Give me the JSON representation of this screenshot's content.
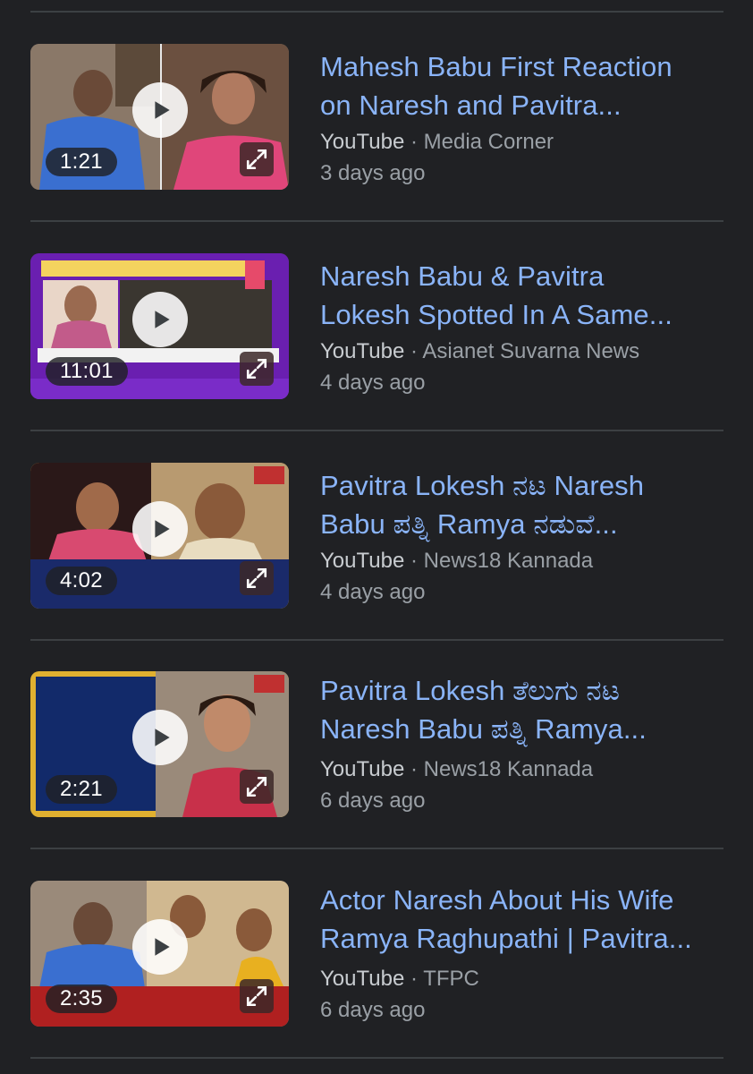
{
  "results": [
    {
      "title_line1": "Mahesh Babu First Reaction",
      "title_line2": "on Naresh and Pavitra...",
      "source": "YouTube",
      "separator": " · ",
      "channel": "Media Corner",
      "age": "3 days ago",
      "duration": "1:21"
    },
    {
      "title_line1": "Naresh Babu & Pavitra",
      "title_line2": "Lokesh Spotted In A Same...",
      "source": "YouTube",
      "separator": " · ",
      "channel": "Asianet Suvarna News",
      "age": "4 days ago",
      "duration": "11:01"
    },
    {
      "title_line1": "Pavitra Lokesh ನಟ Naresh",
      "title_line2": "Babu ಪತ್ನಿ Ramya ನಡುವೆ...",
      "source": "YouTube",
      "separator": " · ",
      "channel": "News18 Kannada",
      "age": "4 days ago",
      "duration": "4:02"
    },
    {
      "title_line1": "Pavitra Lokesh ತೆಲುಗು ನಟ",
      "title_line2": "Naresh Babu ಪತ್ನಿ Ramya...",
      "source": "YouTube",
      "separator": " · ",
      "channel": "News18 Kannada",
      "age": "6 days ago",
      "duration": "2:21"
    },
    {
      "title_line1": "Actor Naresh About His Wife",
      "title_line2": "Ramya Raghupathi | Pavitra...",
      "source": "YouTube",
      "separator": " · ",
      "channel": "TFPC",
      "age": "6 days ago",
      "duration": "2:35"
    }
  ],
  "colors": {
    "background": "#202124",
    "title_link": "#8ab4f8",
    "meta_text": "#9aa0a6",
    "divider": "#3c4043"
  },
  "icons": {
    "play": "play-icon",
    "expand": "expand-icon"
  }
}
